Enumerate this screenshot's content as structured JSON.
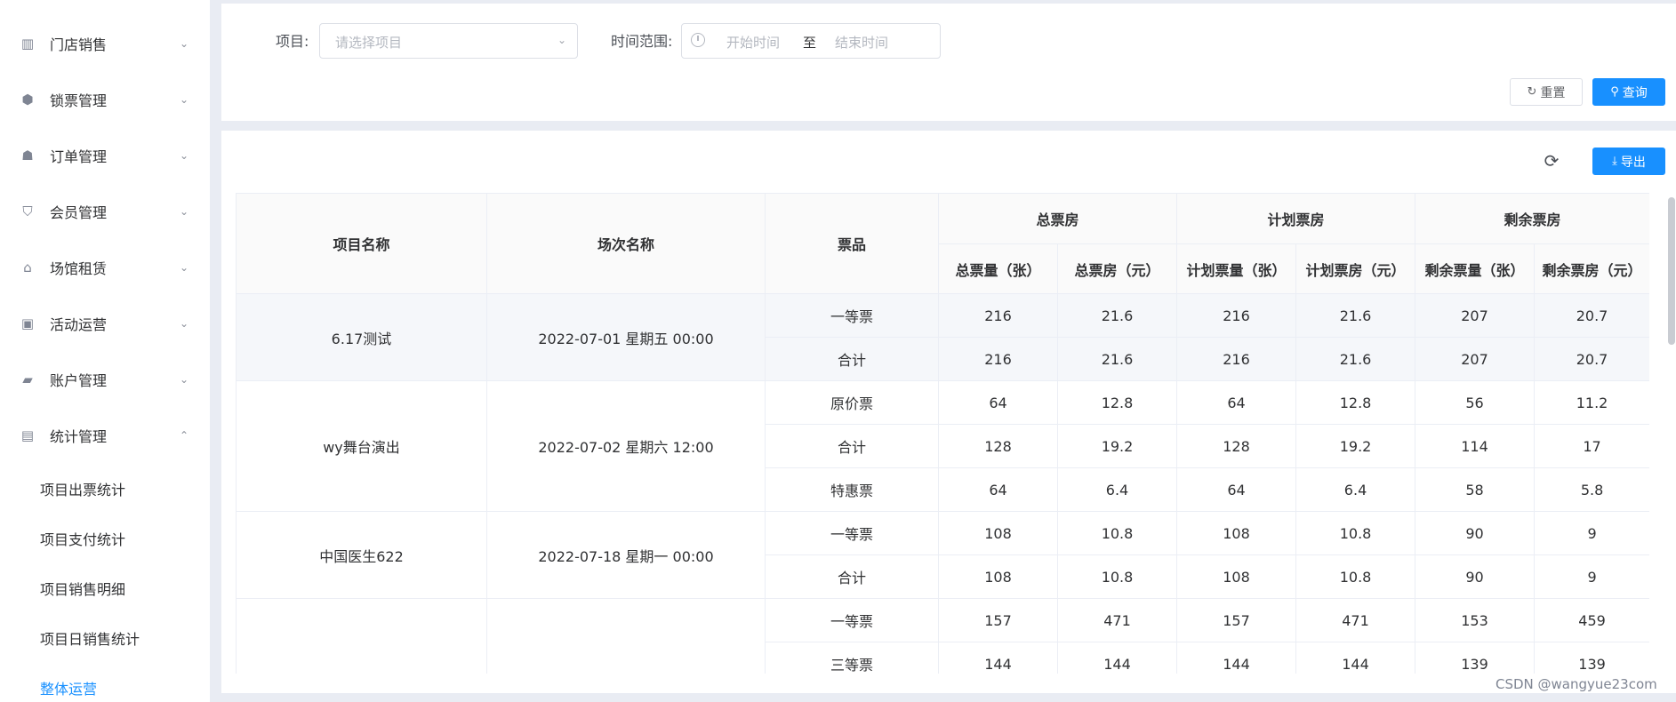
{
  "sidebar": {
    "menu": [
      {
        "label": "门店销售",
        "icon": "chart-bar-icon",
        "glyph": "▥",
        "chev": "⌄"
      },
      {
        "label": "锁票管理",
        "icon": "cube-icon",
        "glyph": "⬢",
        "chev": "⌄"
      },
      {
        "label": "订单管理",
        "icon": "graduation-cap-icon",
        "glyph": "☗",
        "chev": "⌄"
      },
      {
        "label": "会员管理",
        "icon": "shield-icon",
        "glyph": "⛉",
        "chev": "⌄"
      },
      {
        "label": "场馆租赁",
        "icon": "home-icon",
        "glyph": "⌂",
        "chev": "⌄"
      },
      {
        "label": "活动运营",
        "icon": "tv-icon",
        "glyph": "▣",
        "chev": "⌄"
      },
      {
        "label": "账户管理",
        "icon": "wallet-icon",
        "glyph": "▰",
        "chev": "⌄"
      },
      {
        "label": "统计管理",
        "icon": "document-icon",
        "glyph": "▤",
        "chev": "⌃"
      }
    ],
    "submenu": [
      {
        "label": "项目出票统计",
        "active": false
      },
      {
        "label": "项目支付统计",
        "active": false
      },
      {
        "label": "项目销售明细",
        "active": false
      },
      {
        "label": "项目日销售统计",
        "active": false
      },
      {
        "label": "整体运营",
        "active": true
      }
    ]
  },
  "filters": {
    "project_label": "项目:",
    "project_placeholder": "请选择项目",
    "time_label": "时间范围:",
    "start_placeholder": "开始时间",
    "range_separator": "至",
    "end_placeholder": "结束时间",
    "reset_label": "重置",
    "query_label": "查询"
  },
  "toolbar": {
    "export_label": "导出"
  },
  "table": {
    "headers": {
      "project_name": "项目名称",
      "session_name": "场次名称",
      "ticket": "票品",
      "total_group": "总票房",
      "plan_group": "计划票房",
      "remain_group": "剩余票房",
      "total_qty": "总票量（张）",
      "total_amt": "总票房（元）",
      "plan_qty": "计划票量（张）",
      "plan_amt": "计划票房（元）",
      "remain_qty": "剩余票量（张）",
      "remain_amt": "剩余票房（元）"
    },
    "groups": [
      {
        "project": "6.17测试",
        "session": "2022-07-01 星期五 00:00",
        "rows": [
          [
            "一等票",
            "216",
            "21.6",
            "216",
            "21.6",
            "207",
            "20.7"
          ],
          [
            "合计",
            "216",
            "21.6",
            "216",
            "21.6",
            "207",
            "20.7"
          ]
        ]
      },
      {
        "project": "wy舞台演出",
        "session": "2022-07-02 星期六 12:00",
        "rows": [
          [
            "原价票",
            "64",
            "12.8",
            "64",
            "12.8",
            "56",
            "11.2"
          ],
          [
            "合计",
            "128",
            "19.2",
            "128",
            "19.2",
            "114",
            "17"
          ],
          [
            "特惠票",
            "64",
            "6.4",
            "64",
            "6.4",
            "58",
            "5.8"
          ]
        ]
      },
      {
        "project": "中国医生622",
        "session": "2022-07-18 星期一 00:00",
        "rows": [
          [
            "一等票",
            "108",
            "10.8",
            "108",
            "10.8",
            "90",
            "9"
          ],
          [
            "合计",
            "108",
            "10.8",
            "108",
            "10.8",
            "90",
            "9"
          ]
        ]
      },
      {
        "project": "",
        "session": "",
        "rows": [
          [
            "一等票",
            "157",
            "471",
            "157",
            "471",
            "153",
            "459"
          ],
          [
            "三等票",
            "144",
            "144",
            "144",
            "144",
            "139",
            "139"
          ]
        ]
      }
    ]
  },
  "watermark": "CSDN @wangyue23com",
  "colors": {
    "primary": "#1890ff",
    "highlight_row": "#f5f7fa",
    "header_bg": "#fafafa"
  }
}
